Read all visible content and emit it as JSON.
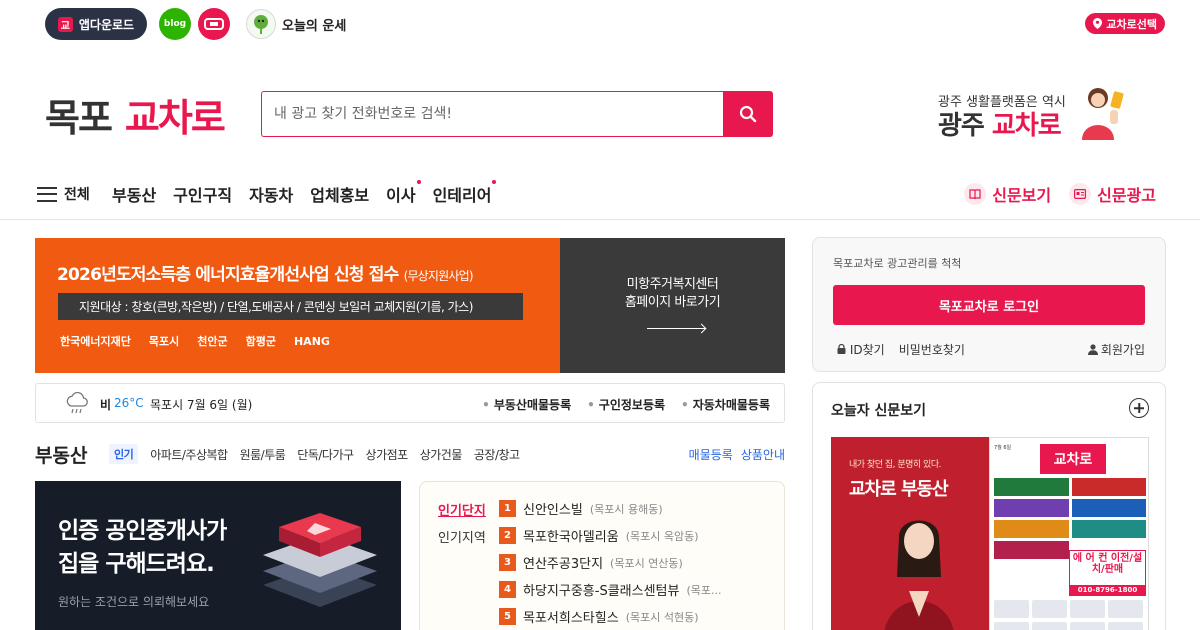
{
  "topbar": {
    "app_download": "앱다운로드",
    "blog_label": "blog",
    "fortune_label": "오늘의 운세",
    "region_select": "교차로선택"
  },
  "header": {
    "logo_part1": "목포",
    "logo_part2": "교차로",
    "search_placeholder": "내 광고 찾기 전화번호로 검색!",
    "promo_sub": "광주 생활플랫폼은 역시",
    "promo_main1": "광주",
    "promo_main2": "교차로"
  },
  "nav": {
    "all_label": "전체",
    "items": [
      "부동산",
      "구인구직",
      "자동차",
      "업체홍보",
      "이사",
      "인테리어"
    ],
    "right": [
      "신문보기",
      "신문광고"
    ]
  },
  "banner": {
    "title": "2026년도저소득층 에너지효율개선사업 신청 접수",
    "title_tag": "(무상지원사업)",
    "target": "지원대상 : 창호(큰방,작은방) / 단열,도배공사 / 콘덴싱 보일러 교체지원(기름, 가스)",
    "logos": [
      "한국에너지재단",
      "목포시",
      "천안군",
      "함평군",
      "HANG"
    ],
    "side_line1": "미항주거복지센터",
    "side_line2": "홈페이지 바로가기"
  },
  "weather": {
    "condition": "비",
    "temperature": "26°C",
    "date": "목포시 7월 6일 (월)",
    "links": [
      "부동산매물등록",
      "구인정보등록",
      "자동차매물등록"
    ]
  },
  "real_estate": {
    "title": "부동산",
    "tabs": [
      "인기",
      "아파트/주상복합",
      "원룸/투룸",
      "단독/다가구",
      "상가점포",
      "상가건물",
      "공장/창고"
    ],
    "links": [
      "매물등록",
      "상품안내"
    ],
    "card_line1": "인증 공인중개사가",
    "card_line2": "집을 구해드려요.",
    "card_sub": "원하는 조건으로 의뢰해보세요",
    "rank_tabs": [
      "인기단지",
      "인기지역"
    ],
    "ranks": [
      {
        "num": "1",
        "name": "신안인스빌",
        "loc": "(목포시 용해동)"
      },
      {
        "num": "2",
        "name": "목포한국아델리움",
        "loc": "(목포시 옥암동)"
      },
      {
        "num": "3",
        "name": "연산주공3단지",
        "loc": "(목포시 연산동)"
      },
      {
        "num": "4",
        "name": "하당지구중흥-S클래스센텀뷰",
        "loc": "(목포..."
      },
      {
        "num": "5",
        "name": "목포서희스타힐스",
        "loc": "(목포시 석현동)"
      }
    ]
  },
  "login": {
    "caption": "목포교차로 광고관리를 척척",
    "button": "목포교차로 로그인",
    "find_id": "ID찾기",
    "find_pw": "비밀번호찾기",
    "join": "회원가입"
  },
  "newspaper": {
    "title": "오늘자 신문보기",
    "cover_small": "내가 찾던 집, 분명히 있다.",
    "cover_big": "교차로 부동산",
    "mast": "교차로",
    "big_ad": "에 어 컨 이전/설치/판매",
    "phone": "010-8796-1800"
  },
  "colors": {
    "brand": "#e8174e",
    "dark": "#2b3245",
    "banner_orange": "#f15a11",
    "link_blue": "#2864e8"
  }
}
